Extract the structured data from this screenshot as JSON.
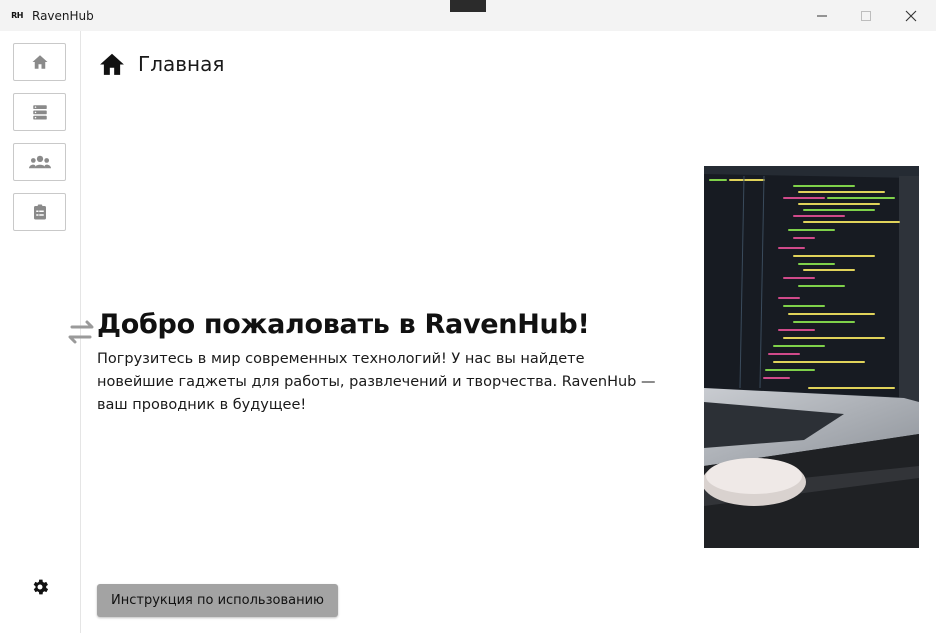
{
  "window": {
    "logo_text": "RH",
    "title": "RavenHub"
  },
  "sidebar": {
    "items": [
      {
        "name": "home",
        "icon": "home-icon"
      },
      {
        "name": "catalog",
        "icon": "list-icon"
      },
      {
        "name": "users",
        "icon": "group-icon"
      },
      {
        "name": "orders",
        "icon": "clipboard-icon"
      }
    ],
    "settings_icon": "gear-icon"
  },
  "header": {
    "title": "Главная",
    "icon": "home-icon"
  },
  "main": {
    "welcome_title": "Добро пожаловать в RavenHub!",
    "welcome_text": "Погрузитесь в мир современных технологий! У нас вы найдете новейшие гаджеты для работы, развлечений и творчества. RavenHub — ваш проводник в будущее!",
    "guide_button": "Инструкция по использованию"
  },
  "colors": {
    "icon_gray": "#8a8a8a",
    "button_bg": "#a3a3a3",
    "titlebar_bg": "#f3f3f3"
  }
}
